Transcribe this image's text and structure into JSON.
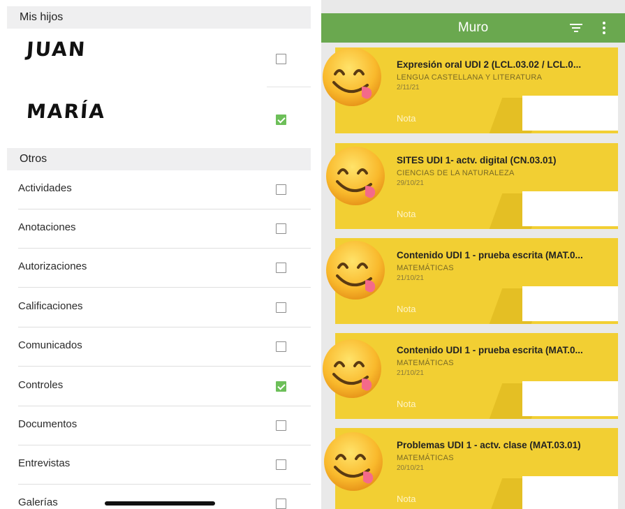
{
  "left": {
    "section_children": "Mis hijos",
    "children": [
      {
        "name": "JUAN",
        "checked": false
      },
      {
        "name": "MARÍA",
        "checked": true
      }
    ],
    "section_other": "Otros",
    "items": [
      {
        "label": "Actividades",
        "checked": false
      },
      {
        "label": "Anotaciones",
        "checked": false
      },
      {
        "label": "Autorizaciones",
        "checked": false
      },
      {
        "label": "Calificaciones",
        "checked": false
      },
      {
        "label": "Comunicados",
        "checked": false
      },
      {
        "label": "Controles",
        "checked": true
      },
      {
        "label": "Documentos",
        "checked": false
      },
      {
        "label": "Entrevistas",
        "checked": false
      },
      {
        "label": "Galerías",
        "checked": false
      }
    ]
  },
  "right": {
    "appbar_title": "Muro",
    "icons": {
      "filter": "filter-icon",
      "more": "more-vertical-icon"
    },
    "cards": [
      {
        "title": "Expresión oral UDI 2 (LCL.03.02 / LCL.0...",
        "subject": "LENGUA CASTELLANA Y LITERATURA",
        "date": "2/11/21",
        "note_label": "Nota"
      },
      {
        "title": "SITES UDI 1- actv. digital (CN.03.01)",
        "subject": "CIENCIAS DE LA NATURALEZA",
        "date": "29/10/21",
        "note_label": "Nota"
      },
      {
        "title": "Contenido UDI 1 - prueba escrita (MAT.0...",
        "subject": "MATEMÁTICAS",
        "date": "21/10/21",
        "note_label": "Nota"
      },
      {
        "title": "Contenido UDI 1 - prueba escrita (MAT.0...",
        "subject": "MATEMÁTICAS",
        "date": "21/10/21",
        "note_label": "Nota"
      },
      {
        "title": "Problemas UDI 1 - actv. clase (MAT.03.01)",
        "subject": "MATEMÁTICAS",
        "date": "20/10/21",
        "note_label": "Nota"
      }
    ]
  },
  "colors": {
    "appbar": "#6aa84f",
    "card": "#f2cf33",
    "checked": "#6dbf59"
  }
}
